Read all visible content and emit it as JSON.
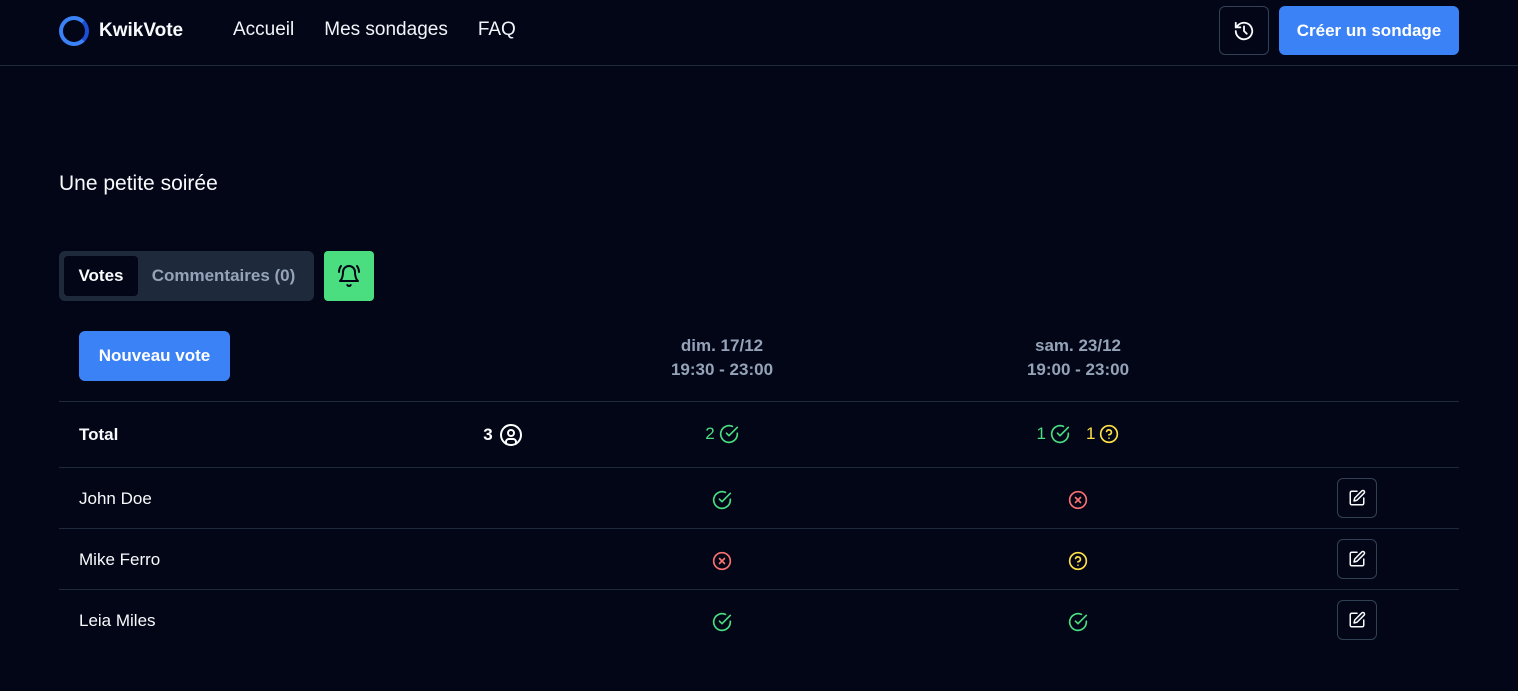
{
  "header": {
    "brand": "KwikVote",
    "nav": [
      "Accueil",
      "Mes sondages",
      "FAQ"
    ],
    "create_label": "Créer un sondage"
  },
  "poll": {
    "title": "Une petite soirée",
    "tabs": {
      "votes": "Votes",
      "comments": "Commentaires (0)"
    },
    "new_vote_label": "Nouveau vote",
    "options": [
      {
        "date": "dim. 17/12",
        "time": "19:30 - 23:00"
      },
      {
        "date": "sam. 23/12",
        "time": "19:00 - 23:00"
      }
    ],
    "total": {
      "label": "Total",
      "participants": "3",
      "option1_yes": "2",
      "option2_yes": "1",
      "option2_maybe": "1"
    },
    "voters": [
      {
        "name": "John Doe",
        "votes": [
          "yes",
          "no"
        ]
      },
      {
        "name": "Mike Ferro",
        "votes": [
          "no",
          "maybe"
        ]
      },
      {
        "name": "Leia Miles",
        "votes": [
          "yes",
          "yes"
        ]
      }
    ]
  },
  "colors": {
    "accent": "#3b82f6",
    "yes": "#4ade80",
    "no": "#f87171",
    "maybe": "#fde047",
    "background": "#020617"
  },
  "icons": {
    "history": "history-icon",
    "bell": "bell-ring-icon",
    "user": "user-circle-icon",
    "yes": "check-circle-icon",
    "no": "x-circle-icon",
    "maybe": "question-circle-icon",
    "edit": "edit-icon"
  }
}
